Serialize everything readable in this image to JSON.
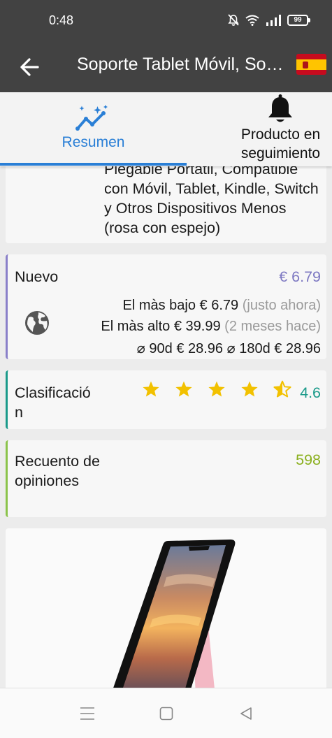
{
  "status_bar": {
    "time": "0:48",
    "battery": "99",
    "icons": [
      "mute-icon",
      "wifi-icon",
      "signal-icon",
      "battery-icon"
    ]
  },
  "app_bar": {
    "title": "Soporte Tablet Móvil, Soporte Tablet Plegable Portátil",
    "back_icon": "back-arrow-icon",
    "flag": "spain-flag-icon"
  },
  "tabs": [
    {
      "label": "Resumen",
      "icon": "trend-chart-icon",
      "active": true
    },
    {
      "label": "Producto en seguimiento",
      "icon": "bell-icon",
      "active": false
    }
  ],
  "description": {
    "text": "Plegable Portátil, Compatible con Móvil, Tablet, Kindle, Switch y Otros Dispositivos Menos (rosa con espejo)"
  },
  "price": {
    "label": "Nuevo",
    "current": "€ 6.79",
    "lowest_label": "El màs bajo",
    "lowest_value": "€ 6.79",
    "lowest_when": "(justo ahora)",
    "highest_label": "El màs alto",
    "highest_value": "€ 39.99",
    "highest_when": "(2 meses hace)",
    "avg90_label": "⌀ 90d",
    "avg90_value": "€ 28.96",
    "avg180_label": "⌀ 180d",
    "avg180_value": "€ 28.96",
    "accent": "#8a80c9"
  },
  "rating": {
    "label": "Clasificación",
    "value": "4.6",
    "stars": 4.6,
    "star_color": "#f2c100",
    "accent": "#1a9a8a"
  },
  "reviews": {
    "label": "Recuento de opiniones",
    "value": "598",
    "accent": "#8bc34a"
  },
  "product_image": {
    "alt": "phone on pink stand"
  },
  "nav_bar": {
    "buttons": [
      "menu-icon",
      "home-icon",
      "back-icon"
    ]
  }
}
